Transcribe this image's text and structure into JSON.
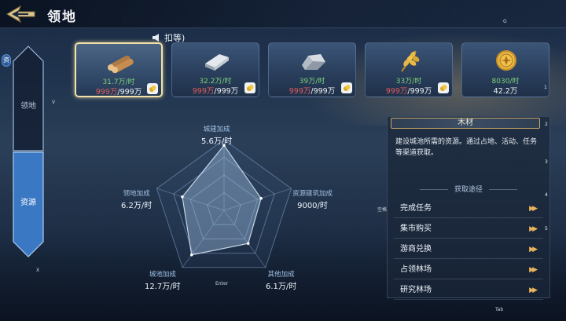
{
  "header": {
    "title": "领地"
  },
  "hints": {
    "g": "G",
    "v": "V",
    "x": "X",
    "enter": "Enter",
    "tab": "Tab",
    "keep": "空格",
    "n1": "1",
    "n2": "2",
    "n3": "3",
    "n4": "4",
    "n5": "5"
  },
  "notice": {
    "text": "扣等)"
  },
  "side_tabs": [
    {
      "label": "领地",
      "active": false
    },
    {
      "label": "资源",
      "active": true
    }
  ],
  "side_glyph": "资",
  "resources": [
    {
      "icon": "wood-icon",
      "rate": "31.7万/时",
      "current": "999万",
      "max": "999万",
      "selected": true
    },
    {
      "icon": "iron-icon",
      "rate": "32.2万/时",
      "current": "999万",
      "max": "999万",
      "selected": false
    },
    {
      "icon": "stone-icon",
      "rate": "39万/时",
      "current": "999万",
      "max": "999万",
      "selected": false
    },
    {
      "icon": "grain-icon",
      "rate": "33万/时",
      "current": "999万",
      "max": "999万",
      "selected": false
    },
    {
      "icon": "coin-icon",
      "rate": "8030/时",
      "current": "42.2万",
      "max": "",
      "selected": false
    }
  ],
  "stats": [
    {
      "label": "城建加成",
      "value": "5.6万/时"
    },
    {
      "label": "资源建筑加成",
      "value": "9000/时"
    },
    {
      "label": "其他加成",
      "value": "6.1万/时"
    },
    {
      "label": "城池加成",
      "value": "12.7万/时"
    },
    {
      "label": "领地加成",
      "value": "6.2万/时"
    }
  ],
  "radar_values": [
    0.92,
    0.55,
    0.58,
    0.78,
    0.62
  ],
  "panel": {
    "title": "木材",
    "description": "建设城池所需的资源。通过占地、活动、任务等渠道获取。",
    "subtitle": "获取途径",
    "routes": [
      "完成任务",
      "集市购买",
      "游商兑换",
      "占领林场",
      "研究林场"
    ],
    "arrow": "▶▶"
  },
  "colors": {
    "accent": "#f2e2a8",
    "rate_green": "#7ed17a",
    "amount_red": "#e05c5c",
    "arrow_gold": "#e8b35a"
  }
}
